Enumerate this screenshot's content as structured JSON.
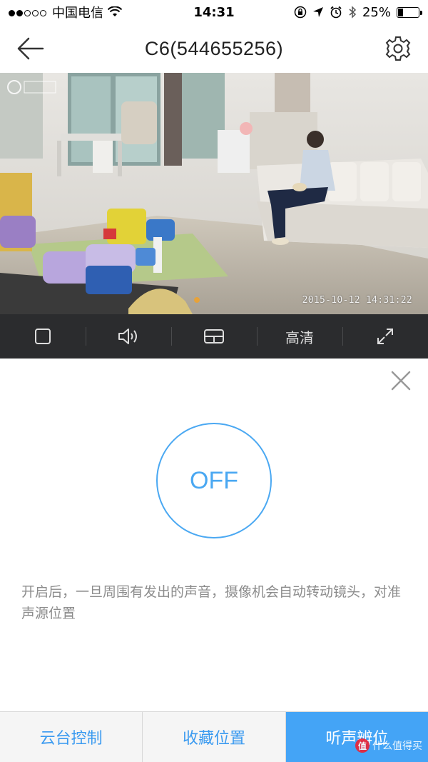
{
  "status_bar": {
    "carrier": "中国电信",
    "time": "14:31",
    "battery_percent": "25%",
    "battery_level": 0.25,
    "signal_dots_filled": 2,
    "signal_dots_total": 5
  },
  "header": {
    "title": "C6(544655256)",
    "back_icon": "back-arrow-icon",
    "settings_icon": "gear-icon"
  },
  "video": {
    "timestamp": "2015-10-12 14:31:22",
    "logo_icon": "ezviz-logo-icon"
  },
  "toolbar": {
    "items": [
      {
        "icon": "record-square-icon"
      },
      {
        "icon": "speaker-icon"
      },
      {
        "icon": "split-screen-icon"
      },
      {
        "label": "高清"
      },
      {
        "icon": "fullscreen-expand-icon"
      }
    ]
  },
  "panel": {
    "toggle_label": "OFF",
    "description": "开启后，一旦周围有发出的声音，摄像机会自动转动镜头，对准声源位置",
    "close_icon": "close-icon"
  },
  "bottom_tabs": [
    {
      "label": "云台控制",
      "active": false
    },
    {
      "label": "收藏位置",
      "active": false
    },
    {
      "label": "听声辨位",
      "active": true
    }
  ],
  "watermark": {
    "text": "什么值得买",
    "logo_text": "值"
  },
  "colors": {
    "accent": "#44a4f6",
    "toolbar_bg": "#2b2c2e",
    "circle": "#4aa8f2",
    "description_text": "#8c8c8c"
  }
}
